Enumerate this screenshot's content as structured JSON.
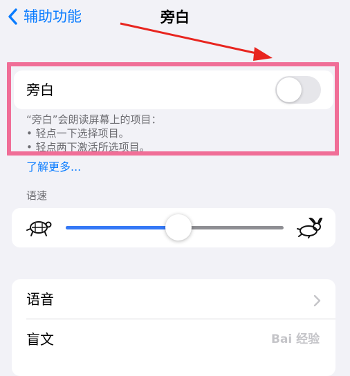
{
  "nav": {
    "back_label": "辅助功能",
    "title": "旁白"
  },
  "voiceover": {
    "label": "旁白",
    "enabled": false,
    "description": [
      "“旁白”会朗读屏幕上的项目：",
      "•  轻点一下选择项目。",
      "•  轻点两下激活所选项目。"
    ],
    "learn_more": "了解更多..."
  },
  "speaking_rate": {
    "header": "语速",
    "value_fraction": 0.5
  },
  "list": {
    "items": [
      {
        "label": "语音"
      },
      {
        "label": "盲文"
      }
    ]
  },
  "watermark": "Bai 经验",
  "colors": {
    "accent": "#0a7cff",
    "highlight": "#f06e97",
    "arrow": "#e8251f",
    "slider_fill": "#3478f6"
  }
}
